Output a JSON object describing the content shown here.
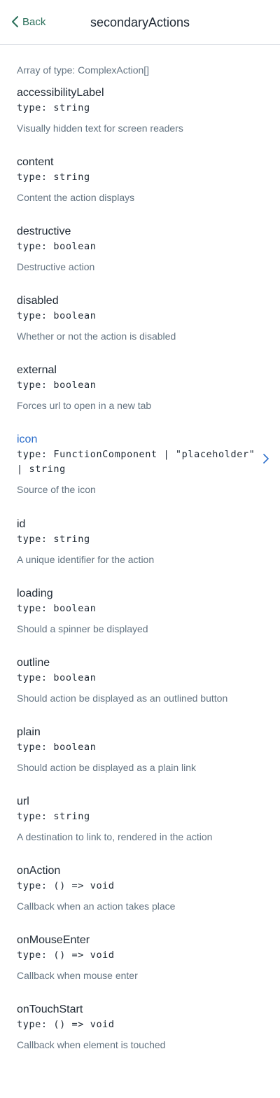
{
  "header": {
    "back_label": "Back",
    "title": "secondaryActions"
  },
  "array_type": "Array of type: ComplexAction[]",
  "props": [
    {
      "name": "accessibilityLabel",
      "type": "type: string",
      "desc": "Visually hidden text for screen readers"
    },
    {
      "name": "content",
      "type": "type: string",
      "desc": "Content the action displays"
    },
    {
      "name": "destructive",
      "type": "type: boolean",
      "desc": "Destructive action"
    },
    {
      "name": "disabled",
      "type": "type: boolean",
      "desc": "Whether or not the action is disabled"
    },
    {
      "name": "external",
      "type": "type: boolean",
      "desc": "Forces url to open in a new tab"
    },
    {
      "name": "icon",
      "type": "type: FunctionComponent | \"placeholder\" | string",
      "desc": "Source of the icon"
    },
    {
      "name": "id",
      "type": "type: string",
      "desc": "A unique identifier for the action"
    },
    {
      "name": "loading",
      "type": "type: boolean",
      "desc": "Should a spinner be displayed"
    },
    {
      "name": "outline",
      "type": "type: boolean",
      "desc": "Should action be displayed as an outlined button"
    },
    {
      "name": "plain",
      "type": "type: boolean",
      "desc": "Should action be displayed as a plain link"
    },
    {
      "name": "url",
      "type": "type: string",
      "desc": "A destination to link to, rendered in the action"
    },
    {
      "name": "onAction",
      "type": "type: () => void",
      "desc": "Callback when an action takes place"
    },
    {
      "name": "onMouseEnter",
      "type": "type: () => void",
      "desc": "Callback when mouse enter"
    },
    {
      "name": "onTouchStart",
      "type": "type: () => void",
      "desc": "Callback when element is touched"
    }
  ],
  "colors": {
    "accent": "#2a6f5a",
    "link": "#2c6ecb",
    "text": "#212b36",
    "subdued": "#637381"
  }
}
